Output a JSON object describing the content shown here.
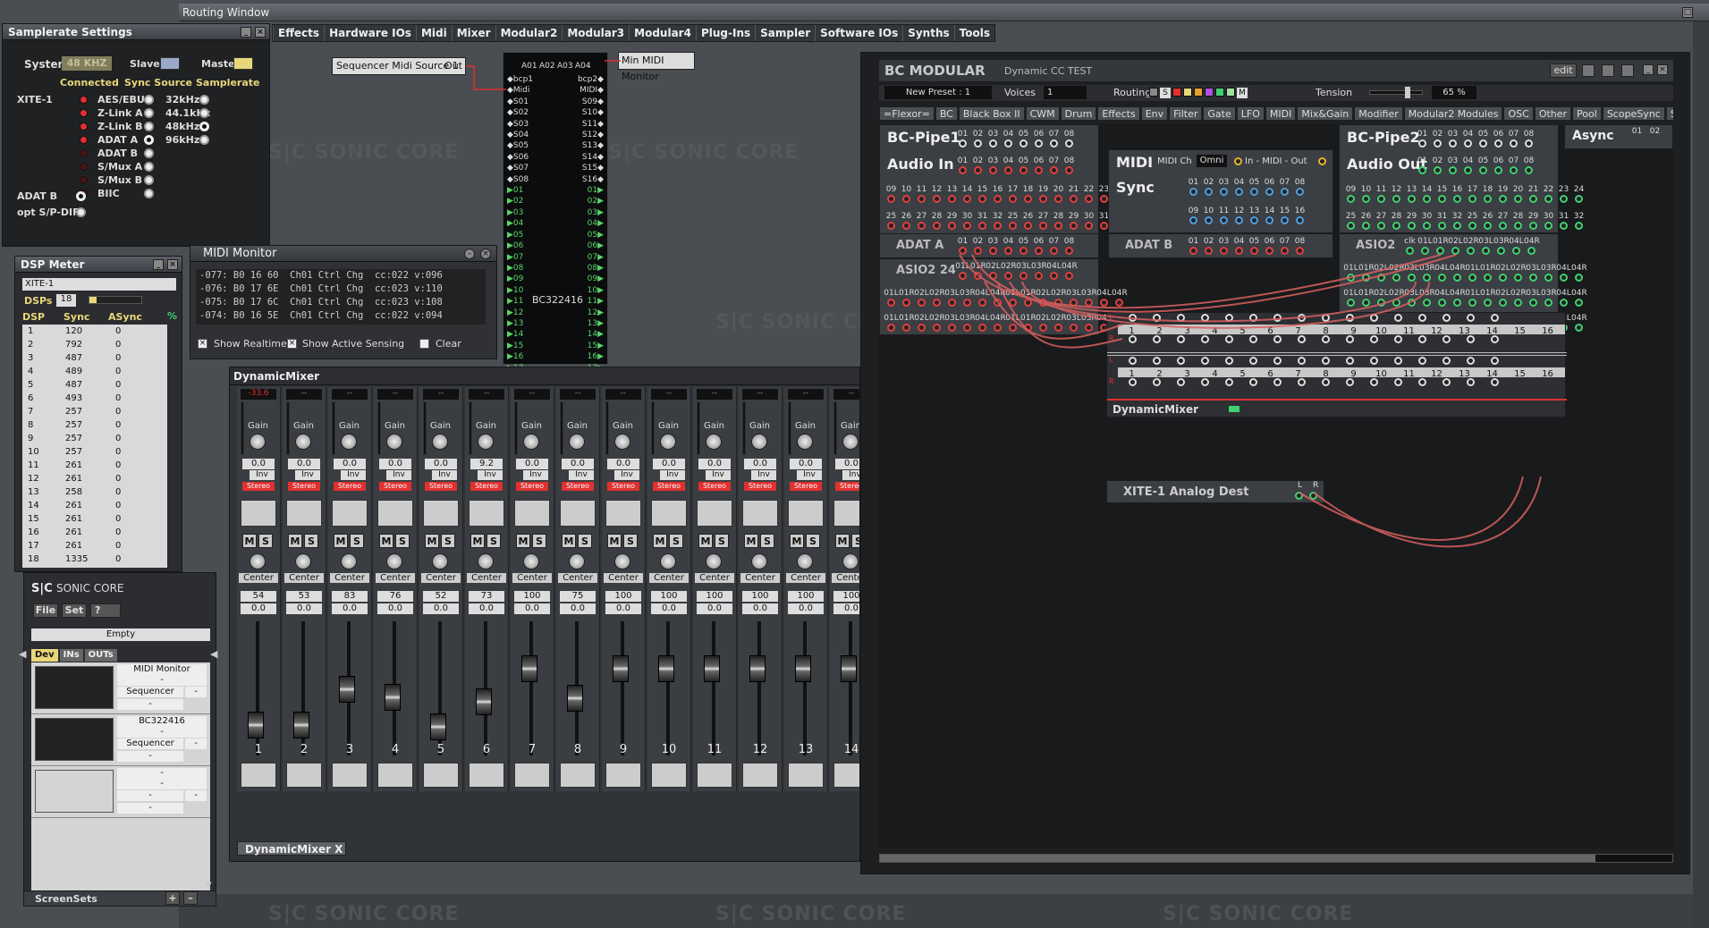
{
  "routing_window": {
    "title": "Routing Window",
    "menu": [
      "Effects",
      "Hardware IOs",
      "Midi",
      "Mixer",
      "Modular2",
      "Modular3",
      "Modular4",
      "Plug-Ins",
      "Sampler",
      "Software IOs",
      "Synths",
      "Tools"
    ]
  },
  "samplerate": {
    "title": "Samplerate Settings",
    "system_label": "System",
    "system_value": "48 KHZ",
    "slave_label": "Slave",
    "master_label": "Master",
    "connected_label": "Connected",
    "sync_source_label": "Sync Source",
    "samplerate_label": "Samplerate",
    "device": "XITE-1",
    "sources": [
      "AES/EBU",
      "Z-Link A",
      "Z-Link B",
      "ADAT A",
      "ADAT B",
      "S/Mux A",
      "S/Mux B",
      "BIIC"
    ],
    "rates": [
      "32kHz",
      "44.1kHz",
      "48kHz",
      "96kHz"
    ],
    "adat_b": "ADAT B",
    "opt_spdif": "opt S/P-DIF"
  },
  "seq_source": {
    "label": "Sequencer Midi Source 1",
    "out": "Out"
  },
  "midi_monitor_tag": "Min MIDI Monitor",
  "bc322416": {
    "header": [
      "A01",
      "A02",
      "A03",
      "A04"
    ],
    "left": [
      "bcp1",
      "Midi",
      "S01",
      "S02",
      "S03",
      "S04",
      "S05",
      "S06",
      "S07",
      "S08",
      "01",
      "02",
      "03",
      "04",
      "05",
      "06",
      "07",
      "08",
      "09",
      "10",
      "11",
      "12",
      "13",
      "14",
      "15",
      "16",
      "17"
    ],
    "right": [
      "bcp2",
      "MIDI",
      "S09",
      "S10",
      "S11",
      "S12",
      "S13",
      "S14",
      "S15",
      "S16",
      "01",
      "02",
      "03",
      "04",
      "05",
      "06",
      "07",
      "08",
      "09",
      "10",
      "11",
      "12",
      "13",
      "14",
      "15",
      "16",
      "17"
    ],
    "name": "BC322416"
  },
  "dsp_meter": {
    "title": "DSP Meter",
    "device": "XITE-1",
    "dsps_label": "DSPs",
    "dsps_value": "18",
    "cols": [
      "DSP",
      "Sync",
      "ASync"
    ],
    "rows": [
      [
        "1",
        "120",
        "0"
      ],
      [
        "2",
        "792",
        "0"
      ],
      [
        "3",
        "487",
        "0"
      ],
      [
        "4",
        "489",
        "0"
      ],
      [
        "5",
        "487",
        "0"
      ],
      [
        "6",
        "493",
        "0"
      ],
      [
        "7",
        "257",
        "0"
      ],
      [
        "8",
        "257",
        "0"
      ],
      [
        "9",
        "257",
        "0"
      ],
      [
        "10",
        "257",
        "0"
      ],
      [
        "11",
        "261",
        "0"
      ],
      [
        "12",
        "261",
        "0"
      ],
      [
        "13",
        "258",
        "0"
      ],
      [
        "14",
        "261",
        "0"
      ],
      [
        "15",
        "261",
        "0"
      ],
      [
        "16",
        "261",
        "0"
      ],
      [
        "17",
        "261",
        "0"
      ],
      [
        "18",
        "1335",
        "0"
      ]
    ]
  },
  "midi_monitor": {
    "title": "MIDI Monitor",
    "lines": [
      "-077: B0 16 60  Ch01 Ctrl Chg  cc:022 v:096",
      "-076: B0 17 6E  Ch01 Ctrl Chg  cc:023 v:110",
      "-075: B0 17 6C  Ch01 Ctrl Chg  cc:023 v:108",
      "-074: B0 16 5E  Ch01 Ctrl Chg  cc:022 v:094"
    ],
    "show_realtime": "Show Realtime",
    "show_active": "Show Active Sensing",
    "clear": "Clear"
  },
  "sonic_core": {
    "brand": "SONIC CORE",
    "logo": "S|C",
    "file": "File",
    "set": "Set",
    "help": "?",
    "empty": "Empty",
    "tabs": [
      "Dev",
      "INs",
      "OUTs"
    ],
    "devices": [
      {
        "name": "MIDI Monitor",
        "sub": "Sequencer",
        "fields": [
          "-",
          "-",
          "-"
        ]
      },
      {
        "name": "BC322416",
        "sub": "Sequencer",
        "fields": [
          "-",
          "-",
          "-"
        ]
      },
      {
        "name": "-",
        "sub": "-",
        "fields": [
          "-",
          "-",
          "-"
        ]
      }
    ],
    "screensets": "ScreenSets"
  },
  "mixer": {
    "title": "DynamicMixer",
    "footer": "DynamicMixer X",
    "gain_label": "Gain",
    "pan_label": "Center",
    "stereo_label": "Stereo",
    "inv_label": "Inv",
    "m_label": "M",
    "s_label": "S",
    "channels": [
      {
        "num": "1",
        "peak": "-33.6",
        "gain": "0.0",
        "v1": "54",
        "v2": "0.0",
        "fader": 0.42
      },
      {
        "num": "2",
        "peak": "--",
        "gain": "0.0",
        "v1": "53",
        "v2": "0.0",
        "fader": 0.42
      },
      {
        "num": "3",
        "peak": "--",
        "gain": "0.0",
        "v1": "83",
        "v2": "0.0",
        "fader": 0.65
      },
      {
        "num": "4",
        "peak": "--",
        "gain": "0.0",
        "v1": "76",
        "v2": "0.0",
        "fader": 0.6
      },
      {
        "num": "5",
        "peak": "--",
        "gain": "0.0",
        "v1": "52",
        "v2": "0.0",
        "fader": 0.41
      },
      {
        "num": "6",
        "peak": "--",
        "gain": "9.2",
        "v1": "73",
        "v2": "0.0",
        "fader": 0.57
      },
      {
        "num": "7",
        "peak": "--",
        "gain": "0.0",
        "v1": "100",
        "v2": "0.0",
        "fader": 0.78
      },
      {
        "num": "8",
        "peak": "--",
        "gain": "0.0",
        "v1": "75",
        "v2": "0.0",
        "fader": 0.59
      },
      {
        "num": "9",
        "peak": "--",
        "gain": "0.0",
        "v1": "100",
        "v2": "0.0",
        "fader": 0.78
      },
      {
        "num": "10",
        "peak": "--",
        "gain": "0.0",
        "v1": "100",
        "v2": "0.0",
        "fader": 0.78
      },
      {
        "num": "11",
        "peak": "--",
        "gain": "0.0",
        "v1": "100",
        "v2": "0.0",
        "fader": 0.78
      },
      {
        "num": "12",
        "peak": "--",
        "gain": "0.0",
        "v1": "100",
        "v2": "0.0",
        "fader": 0.78
      },
      {
        "num": "13",
        "peak": "--",
        "gain": "0.0",
        "v1": "100",
        "v2": "0.0",
        "fader": 0.78
      },
      {
        "num": "14",
        "peak": "--",
        "gain": "0.0",
        "v1": "100",
        "v2": "0.0",
        "fader": 0.78
      }
    ]
  },
  "bc_modular": {
    "title": "BC MODULAR",
    "patch": "Dynamic CC TEST",
    "edit": "edit",
    "preset": "New Preset : 1",
    "voices_label": "Voices",
    "voices": "1",
    "routing_label": "Routing",
    "routing_s": "S",
    "routing_m": "M",
    "tension_label": "Tension",
    "tension_value": "65 %",
    "categories": [
      "=Flexor=",
      "BC",
      "Black Box II",
      "CWM",
      "Drum",
      "Effects",
      "Env",
      "Filter",
      "Gate",
      "LFO",
      "MIDI",
      "Mix&Gain",
      "Modifier",
      "Modular2 Modules",
      "OSC",
      "Other",
      "Pool",
      "ScopeSync",
      "S"
    ],
    "pipe1": "BC-Pipe1",
    "audio_in": "Audio In",
    "midi": "MIDI",
    "midi_ch": "MIDI Ch",
    "omni": "Omni",
    "in_midi_out": "In - MIDI - Out",
    "sync": "Sync",
    "pipe2": "BC-Pipe2",
    "audio_out": "Audio Out",
    "async": "Async",
    "adat_a": "ADAT A",
    "adat_b": "ADAT B",
    "asio2": "ASIO2",
    "asio2_24": "ASIO2 24",
    "dynamic_mixer": "DynamicMixer",
    "xite_dest": "XITE-1 Analog Dest",
    "lr": [
      "L",
      "R"
    ],
    "port_rows": [
      [
        "01",
        "02",
        "03",
        "04",
        "05",
        "06",
        "07",
        "08"
      ],
      [
        "09",
        "10",
        "11",
        "12",
        "13",
        "14",
        "15",
        "16"
      ],
      [
        "17",
        "18",
        "19",
        "20",
        "21",
        "22",
        "23",
        "24"
      ],
      [
        "25",
        "26",
        "27",
        "28",
        "29",
        "30",
        "31",
        "32"
      ]
    ],
    "asio_labels": [
      "01L",
      "01R",
      "02L",
      "02R",
      "03L",
      "03R",
      "04L",
      "04R"
    ],
    "asio2_labels": [
      "clk",
      "01L",
      "01R",
      "02L",
      "02R",
      "03L",
      "03R",
      "04L",
      "04R"
    ],
    "mixer_nums": [
      "1",
      "2",
      "3",
      "4",
      "5",
      "6",
      "7",
      "8",
      "9",
      "10",
      "11",
      "12",
      "13",
      "14",
      "15",
      "16"
    ]
  },
  "watermark": "S|C  SONIC CORE",
  "colors": {
    "accent_red": "#e03030",
    "port_green": "#40d070",
    "port_blue": "#4aa0e0",
    "bg": "#4a4d51"
  }
}
